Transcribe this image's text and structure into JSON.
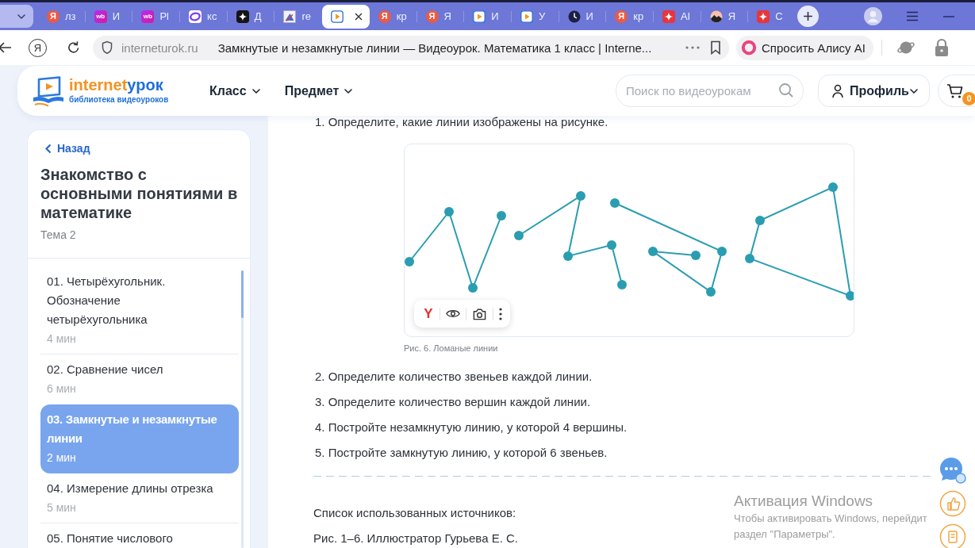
{
  "browser": {
    "tabs": [
      {
        "kind": "yandex",
        "glyph": "Я",
        "title": "лз",
        "selected": false
      },
      {
        "kind": "wb",
        "glyph": "wb",
        "title": "И",
        "selected": false
      },
      {
        "kind": "wb",
        "glyph": "wb",
        "title": "Pl",
        "selected": false
      },
      {
        "kind": "ring",
        "title": "кс",
        "selected": false
      },
      {
        "kind": "sparkle",
        "title": "Д",
        "selected": false
      },
      {
        "kind": "picture",
        "title": "re",
        "selected": false
      },
      {
        "kind": "play",
        "selected": true
      },
      {
        "kind": "yandex",
        "glyph": "Я",
        "title": "кр",
        "selected": false
      },
      {
        "kind": "yandex",
        "glyph": "Я",
        "title": "Я",
        "selected": false
      },
      {
        "kind": "play",
        "title": "И",
        "selected": false
      },
      {
        "kind": "play",
        "title": "У",
        "selected": false
      },
      {
        "kind": "clock",
        "title": "И",
        "selected": false
      },
      {
        "kind": "yandex",
        "glyph": "Я",
        "title": "кр",
        "selected": false
      },
      {
        "kind": "red-sparkle",
        "title": "AI",
        "selected": false
      },
      {
        "kind": "mountain",
        "title": "Я",
        "selected": false
      },
      {
        "kind": "red-sparkle",
        "title": "С",
        "selected": false
      }
    ],
    "home_glyph": "Я",
    "address": {
      "site": "interneturok.ru",
      "title": "Замкнутые и незамкнутые линии — Видеоурок. Математика 1 класс | Interne..."
    },
    "assistant_button": "Спросить Алису AI"
  },
  "site_header": {
    "logo": {
      "part_1": "internet",
      "part_2": "урок",
      "tagline": "библиотека видеоуроков"
    },
    "nav": [
      {
        "label": "Класс"
      },
      {
        "label": "Предмет"
      }
    ],
    "search": {
      "placeholder": "Поиск по видеоурокам"
    },
    "profile_button": "Профиль",
    "cart_count": "0"
  },
  "sidebar": {
    "back_link": "Назад",
    "title": "Знакомство с основными понятиями в математике",
    "subtitle": "Тема 2",
    "lessons": [
      {
        "title": "01. Четырёхугольник. Обозначение четырёхугольника",
        "duration": "4 мин",
        "selected": false
      },
      {
        "title": "02. Сравнение чисел",
        "duration": "6 мин",
        "selected": false
      },
      {
        "title": "03. Замкнутые и незамкнутые линии",
        "duration": "2 мин",
        "selected": true
      },
      {
        "title": "04. Измерение длины отрезка",
        "duration": "5 мин",
        "selected": false
      },
      {
        "title": "05. Понятие числового",
        "selected": false
      }
    ]
  },
  "lesson": {
    "tasks_before": [
      "1. Определите, какие линии изображены на рисунке."
    ],
    "figure": {
      "toolbar_glyph": "Y",
      "caption": "Рис. 6. Ломаные линии"
    },
    "tasks_after": [
      "2. Определите количество звеньев каждой линии.",
      "3. Определите количество вершин каждой линии.",
      "4. Постройте незамкнутую линию, у которой 4 вершины.",
      "5. Постройте замкнутую линию, у которой 6 звеньев."
    ],
    "sources_heading": "Список использованных источников:",
    "sources": [
      "Рис. 1–6. Иллюстратор Гурьева Е. С."
    ]
  },
  "windows_activation": {
    "title": "Активация Windows",
    "lines": [
      "Чтобы активировать Windows, перейдит",
      "раздел \"Параметры\"."
    ]
  }
}
